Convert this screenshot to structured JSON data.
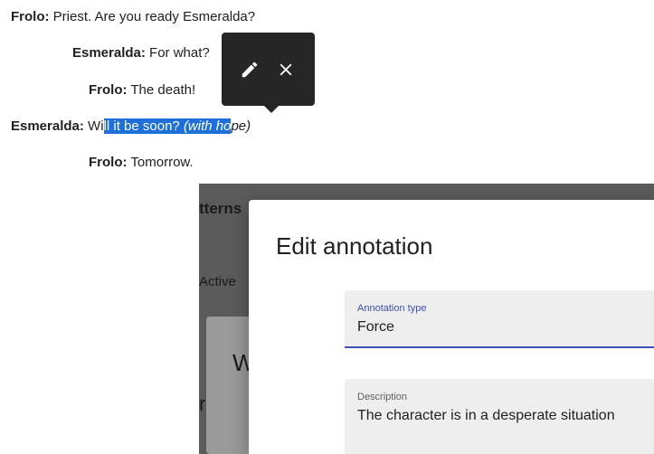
{
  "dialogue": [
    {
      "speaker": "Frolo:",
      "text": " Priest. Are you ready Esmeralda?"
    },
    {
      "speaker": "Esmeralda:",
      "text": " For what?"
    },
    {
      "speaker": "Frolo:",
      "text": " The death!"
    },
    {
      "speaker": "Esmeralda:",
      "pre": " Wi",
      "selected": "ll it be soon? ",
      "selected_italic": "(with ho",
      "post_italic": "pe)"
    },
    {
      "speaker": "Frolo:",
      "text": " Tomorrow."
    }
  ],
  "tooltip": {
    "edit_icon": "pencil-icon",
    "close_icon": "close-icon"
  },
  "background": {
    "fragment1": "tterns",
    "fragment2": "Active",
    "fragment3": "W",
    "fragment4": "r"
  },
  "dialog": {
    "title": "Edit annotation",
    "type_field": {
      "label": "Annotation type",
      "value": "Force"
    },
    "description_field": {
      "label": "Description",
      "value": "The character is in a desperate situation"
    }
  },
  "colors": {
    "accent": "#3f51b5",
    "selection": "#1e6fd9",
    "tooltip_bg": "#262626"
  }
}
